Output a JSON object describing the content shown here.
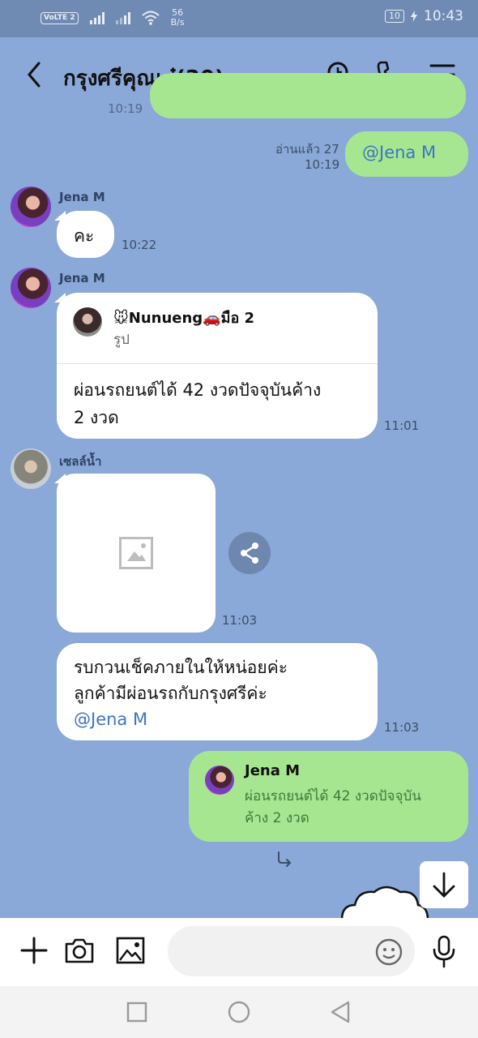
{
  "status_bar": {
    "volte": "VoLTE 2",
    "speed_value": "56",
    "speed_unit": "B/s",
    "battery": "10",
    "time": "10:43"
  },
  "header": {
    "title": "กรุงศรีคุณเอ๋(30)",
    "icons": [
      "back-icon",
      "search-icon",
      "phone-icon",
      "menu-icon"
    ]
  },
  "messages": {
    "top_time": "10:19",
    "m1": {
      "read_label": "อ่านแล้ว 27",
      "time": "10:19",
      "text": "@Jena M"
    },
    "m2": {
      "sender": "Jena M",
      "text": "คะ",
      "time": "10:22"
    },
    "m3": {
      "sender": "Jena M",
      "reply_name": "🐭Nunueng🚗มือ 2",
      "reply_sub": "รูป",
      "text_line1": "ผ่อนรถยนต์ได้ 42 งวดปัจจุบันค้าง",
      "text_line2": "2 งวด",
      "time": "11:01"
    },
    "m4": {
      "sender": "เซลล์น้ำ",
      "time": "11:03"
    },
    "m5": {
      "line1": "รบกวนเช็คภายในให้หน่อยค่ะ",
      "line2": "ลูกค้ามีผ่อนรถกับกรุงศรีค่ะ",
      "mention": "@Jena M",
      "time": "11:03"
    },
    "m6": {
      "reply_name": "Jena M",
      "line1": "ผ่อนรถยนต์ได้ 42 งวดปัจจุบัน",
      "line2": "ค้าง 2 งวด"
    }
  },
  "input": {
    "placeholder": ""
  },
  "colors": {
    "chat_bg": "#8AA8D8",
    "green_bubble": "#A6E690",
    "mention": "#3E74C4"
  }
}
